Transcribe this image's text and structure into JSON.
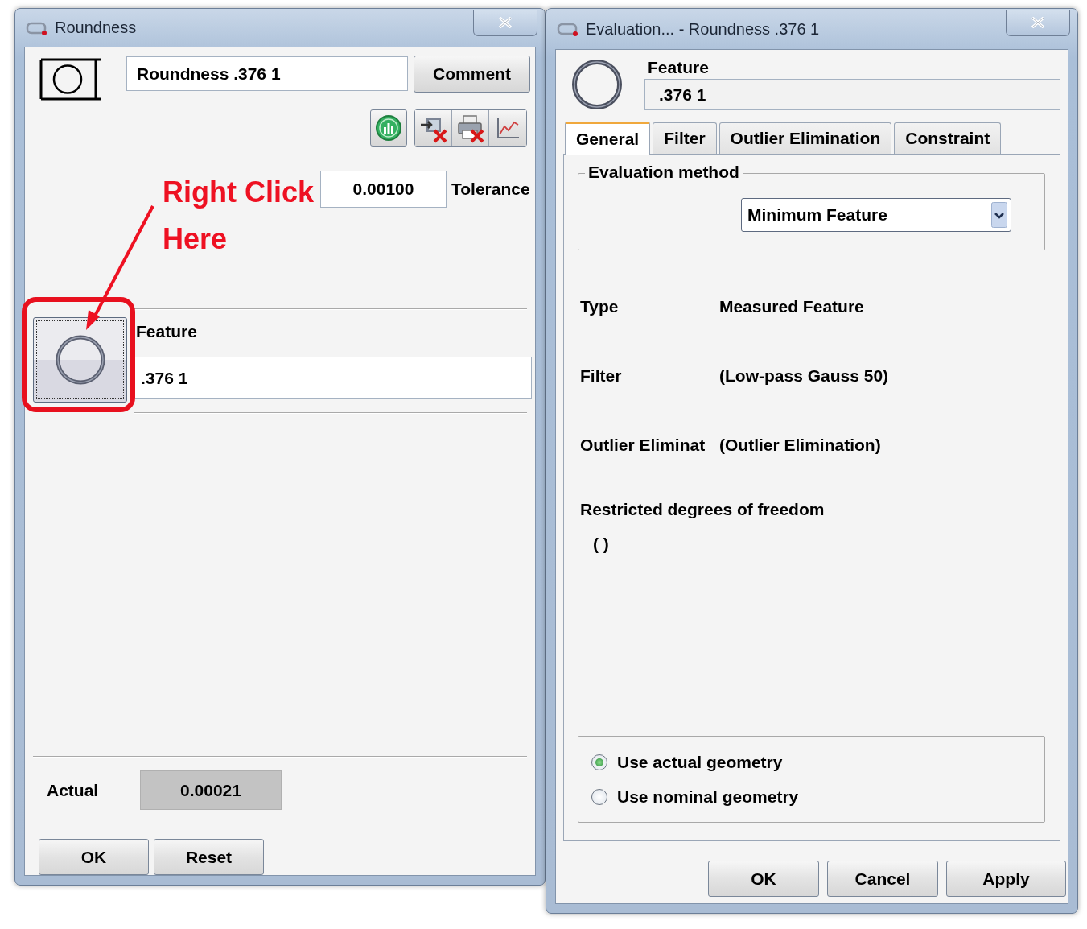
{
  "left_window": {
    "title": "Roundness",
    "name_field": "Roundness .376 1",
    "comment_button": "Comment",
    "tolerance": {
      "value": "0.00100",
      "label": "Tolerance"
    },
    "feature": {
      "label": "Feature",
      "value": ".376 1"
    },
    "actual": {
      "label": "Actual",
      "value": "0.00021"
    },
    "buttons": [
      "OK",
      "Reset"
    ]
  },
  "callout": {
    "text": "Right Click Here"
  },
  "right_window": {
    "title": "Evaluation... - Roundness .376 1",
    "feature": {
      "label": "Feature",
      "value": ".376 1"
    },
    "tabs": [
      {
        "label": "General",
        "selected": true
      },
      {
        "label": "Filter",
        "selected": false
      },
      {
        "label": "Outlier Elimination",
        "selected": false
      },
      {
        "label": "Constraint",
        "selected": false
      }
    ],
    "evaluation_method": {
      "legend": "Evaluation method",
      "value": "Minimum Feature"
    },
    "properties": [
      {
        "label": "Type",
        "value": "Measured Feature"
      },
      {
        "label": "Filter",
        "value": "(Low-pass Gauss 50)"
      },
      {
        "label": "Outlier Eliminat",
        "value": "(Outlier Elimination)"
      }
    ],
    "restricted": {
      "label": "Restricted degrees of freedom",
      "value": "( )"
    },
    "geometry_options": [
      {
        "label": "Use actual geometry",
        "selected": true
      },
      {
        "label": "Use nominal geometry",
        "selected": false
      }
    ],
    "buttons": [
      "OK",
      "Cancel",
      "Apply"
    ]
  }
}
